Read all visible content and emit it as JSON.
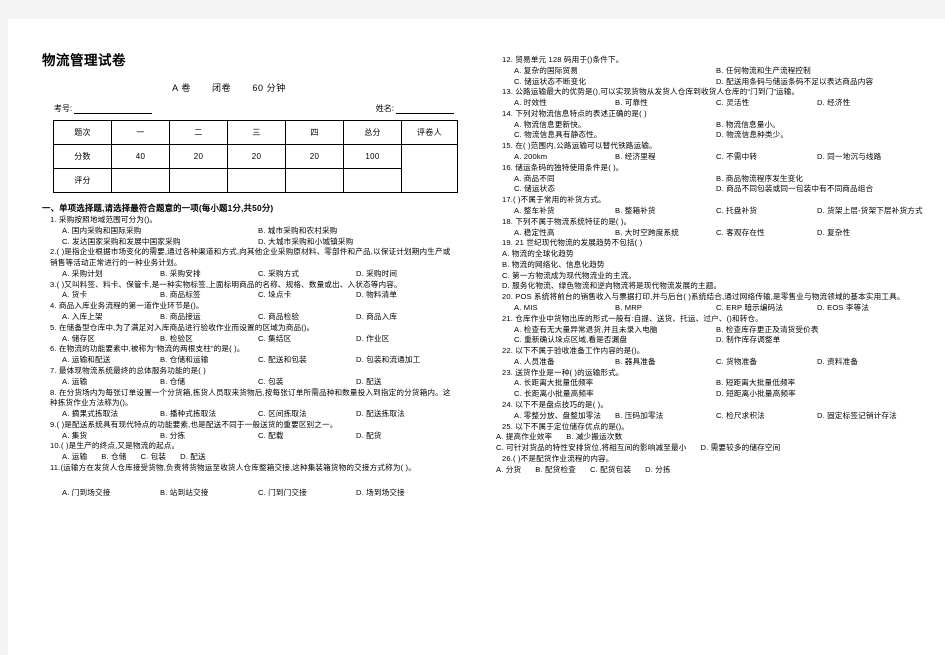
{
  "document": {
    "title": "物流管理试卷",
    "paper_meta": [
      "A 卷",
      "闭卷",
      "60 分钟"
    ],
    "id_fields": [
      {
        "label": "考号:"
      },
      {
        "label": "姓名:"
      }
    ]
  },
  "score_table": {
    "headers": [
      "题次",
      "一",
      "二",
      "三",
      "四",
      "总分",
      "评卷人"
    ],
    "rows": [
      {
        "label": "分数",
        "values": [
          "40",
          "20",
          "20",
          "20",
          "100"
        ]
      },
      {
        "label": "评分",
        "values": [
          "",
          "",
          "",
          "",
          ""
        ]
      }
    ]
  },
  "section": {
    "heading": "一、单项选择题,请选择最符合题意的一项(每小题1分,共50分)"
  },
  "left_questions": [
    {
      "stem": "1. 采购按照地域范围可分为()。",
      "opt_rows": [
        [
          "A. 国内采购和国际采购",
          "B. 城市采购和农村采购"
        ],
        [
          "C. 发达国家采购和发展中国家采购",
          "D. 大城市采购和小城镇采购"
        ]
      ]
    },
    {
      "stem": "2.(    )是指企业根据市场变化的需要,通过各种渠道和方式,向其他企业采购原材料、零部件和产品,以保证计划期内生产或销售等活动正常进行的一种业务计划。",
      "opt_rows": [
        [
          "A. 采购计划",
          "B. 采购安排",
          "C. 采购方式",
          "D. 采购时间"
        ]
      ]
    },
    {
      "stem": "3.(    )又叫料签、料卡、保管卡,是一种实物标签,上面标明商品的名称、规格、数量或出、入状态等内容。",
      "opt_rows": [
        [
          "A. 货卡",
          "B. 商品标签",
          "C. 垛点卡",
          "D. 物料清单"
        ]
      ]
    },
    {
      "stem": "4. 商品入库业务流程的第一道作业环节是()。",
      "opt_rows": [
        [
          "A. 入库上架",
          "B. 商品接运",
          "C. 商品检验",
          "D. 商品入库"
        ]
      ]
    },
    {
      "stem": "5. 在储备型仓库中,为了满足对入库商品进行验收作业而设置的区域为商品()。",
      "opt_rows": [
        [
          "A. 储存区",
          "B. 检验区",
          "C. 集结区",
          "D. 作业区"
        ]
      ]
    },
    {
      "stem": "6. 在物流的功能要素中,被称为“物流的两根支柱”的是(    )。",
      "opt_rows": [
        [
          "A. 运输和配送",
          "B. 仓储和运输",
          "C. 配送和包装",
          "D. 包装和流通加工"
        ]
      ]
    },
    {
      "stem": "7. 最体现物流系统最终的总体服务功能的是(     )",
      "opt_rows": [
        [
          "A. 运输",
          "B. 仓储",
          "C. 包装",
          "D. 配送"
        ]
      ]
    },
    {
      "stem": "8. 在分货场内为每张订单设置一个分货箱,拣货人员取来货物后,按每张订单所需品种和数量投入到指定的分货箱内。这种拣货作业方法称为()。",
      "opt_rows": [
        [
          "A. 摘果式拣取法",
          "B. 播种式拣取法",
          "C. 区间拣取法",
          "D. 配送拣取法"
        ]
      ]
    },
    {
      "stem": "9.(    )是配送系统具有现代特点的功能要素,也是配送不同于一般送货的重要区别之一。",
      "opt_rows": [
        [
          "A. 集货",
          "B. 分拣",
          "C. 配载",
          "D. 配货"
        ]
      ]
    },
    {
      "stem": "10.(     )是生产的终点,又是物流的起点。",
      "opt_rows": [
        [
          "A. 运输",
          "B. 仓储",
          "C. 包装",
          "D. 配送"
        ]
      ],
      "opts_compact": true
    },
    {
      "stem": "11.(运输方在发货人仓库接受货物,负责将货物运至收货人仓库整箱交接,这种集装箱货物的交接方式称为(     )。",
      "opt_rows": [
        [
          "A. 门到场交接",
          "B. 站到站交接",
          "C. 门到门交接",
          "D. 场到场交接"
        ]
      ],
      "gap_before_opts": true
    }
  ],
  "right_questions": [
    {
      "stem": "12. 贸易单元 128 码用于()条件下。",
      "opt_rows": [
        [
          "A. 复杂的国际贸易",
          "B. 任何物流和生产流程控制"
        ],
        [
          "C. 储运状态不断变化",
          "D. 配送用条码与储运条码不足以表达商品内容"
        ]
      ]
    },
    {
      "stem": "13. 公路运输最大的优势是(),可以实现货物从发货人仓库到收货人仓库的“门到门”运输。",
      "opt_rows": [
        [
          "A. 时效性",
          "B. 可靠性",
          "C. 灵活性",
          "D. 经济性"
        ]
      ]
    },
    {
      "stem": "14. 下列对物流信息特点的表述正确的是(       )",
      "opt_rows": [
        [
          "A. 物流信息更新快。",
          "B. 物流信息量小。"
        ],
        [
          "C. 物流信息具有静态性。",
          "D. 物流信息种类少。"
        ]
      ]
    },
    {
      "stem": "15. 在(     )范围内,公路运输可以替代铁路运输。",
      "opt_rows": [
        [
          "A. 200km",
          "B. 经济里程",
          "C. 不需中转",
          "D. 同一地沉与线路"
        ]
      ]
    },
    {
      "stem": "16. 储运条码的独特使用条件是(      )。",
      "opt_rows": [
        [
          "A. 商品不同",
          "B. 商品物流程序发生变化"
        ],
        [
          "C. 储运状态",
          "D. 商品不同包装或同一包装中有不同商品组合"
        ]
      ]
    },
    {
      "stem": "17.(      )不属于常用的补货方式。",
      "opt_rows": [
        [
          "A. 整车补货",
          "B. 整箱补货",
          "C. 托盘补货",
          "D. 货架上层-货架下层补货方式"
        ]
      ]
    },
    {
      "stem": "18. 下列不属于物流系统特征的是(     )。",
      "opt_rows": [
        [
          "A. 稳定性高",
          "B. 大时空跨度系统",
          "C. 客观存在性",
          "D. 复杂性"
        ]
      ]
    },
    {
      "stem": "19. 21 世纪现代物流的发展趋势不包括(     )",
      "opt_rows": [
        [
          "A. 物流的全球化趋势"
        ],
        [
          "B. 物流的网络化、信息化趋势"
        ],
        [
          "C. 第一方物流成为现代物流业的主流。"
        ],
        [
          "D. 服务化物流、绿色物流和逆向物流将是现代物流发展的主题。"
        ]
      ],
      "stacked": true
    },
    {
      "stem": "20. POS 系统将前台的销售收入与票据打印,并与后台(       )系统结合,通过网络传输,是零售业与物流领域的基本实用工具。",
      "opt_rows": [
        [
          "A. MIS",
          "B. MRP",
          "C. ERP 暗示编码法",
          "D. EOS 李等法"
        ]
      ]
    },
    {
      "stem": "21. 仓库作业中货物出库的形式一般有:自提、送货、托运、过户、()和转仓。",
      "opt_rows": [
        [
          "A. 检查有无大量异常退货,并且未录入电脑",
          "B. 检查库存更正及清货受价表"
        ],
        [
          "C. 重新确认垛点区域,看是否漏盘",
          "D. 制作库存调整单"
        ]
      ]
    },
    {
      "stem": "22. 以下不属于验收准备工作内容的是()。",
      "opt_rows": [
        [
          "A. 人员准备",
          "B. 器具准备",
          "C. 货物准备",
          "D. 资料准备"
        ]
      ]
    },
    {
      "stem": "23. 送货作业是一种(      )的运输形式。",
      "opt_rows": [
        [
          "A. 长距离大批量低频率",
          "B. 短距离大批量低频率"
        ],
        [
          "C. 长距离小批量高频率",
          "D. 短距离小批量高频率"
        ]
      ]
    },
    {
      "stem": "24. 以下不是盘点技巧的是(        )。",
      "opt_rows": [
        [
          "A. 零整分放、盘整加零法",
          "B. 压码加零法",
          "C. 检尺求积法",
          "D. 固定标签记销计存法"
        ]
      ]
    },
    {
      "stem": "25. 以下不属于定位储存优点的是()。",
      "opt_rows": [
        [
          "A. 提高作业效率",
          "B. 减少搬运次数"
        ],
        [
          "C. 可针对货品的特性安排货位,将相互间的影响减至最小",
          "D. 需要较多的储存空间"
        ]
      ],
      "opts_full_width": true
    },
    {
      "stem": "26.(      )不是配货作业流程的内容。",
      "opt_rows": [
        [
          "A. 分货",
          "B. 配货检查",
          "C. 配货包装",
          "D. 分拣"
        ]
      ],
      "opts_full_width": true
    }
  ]
}
